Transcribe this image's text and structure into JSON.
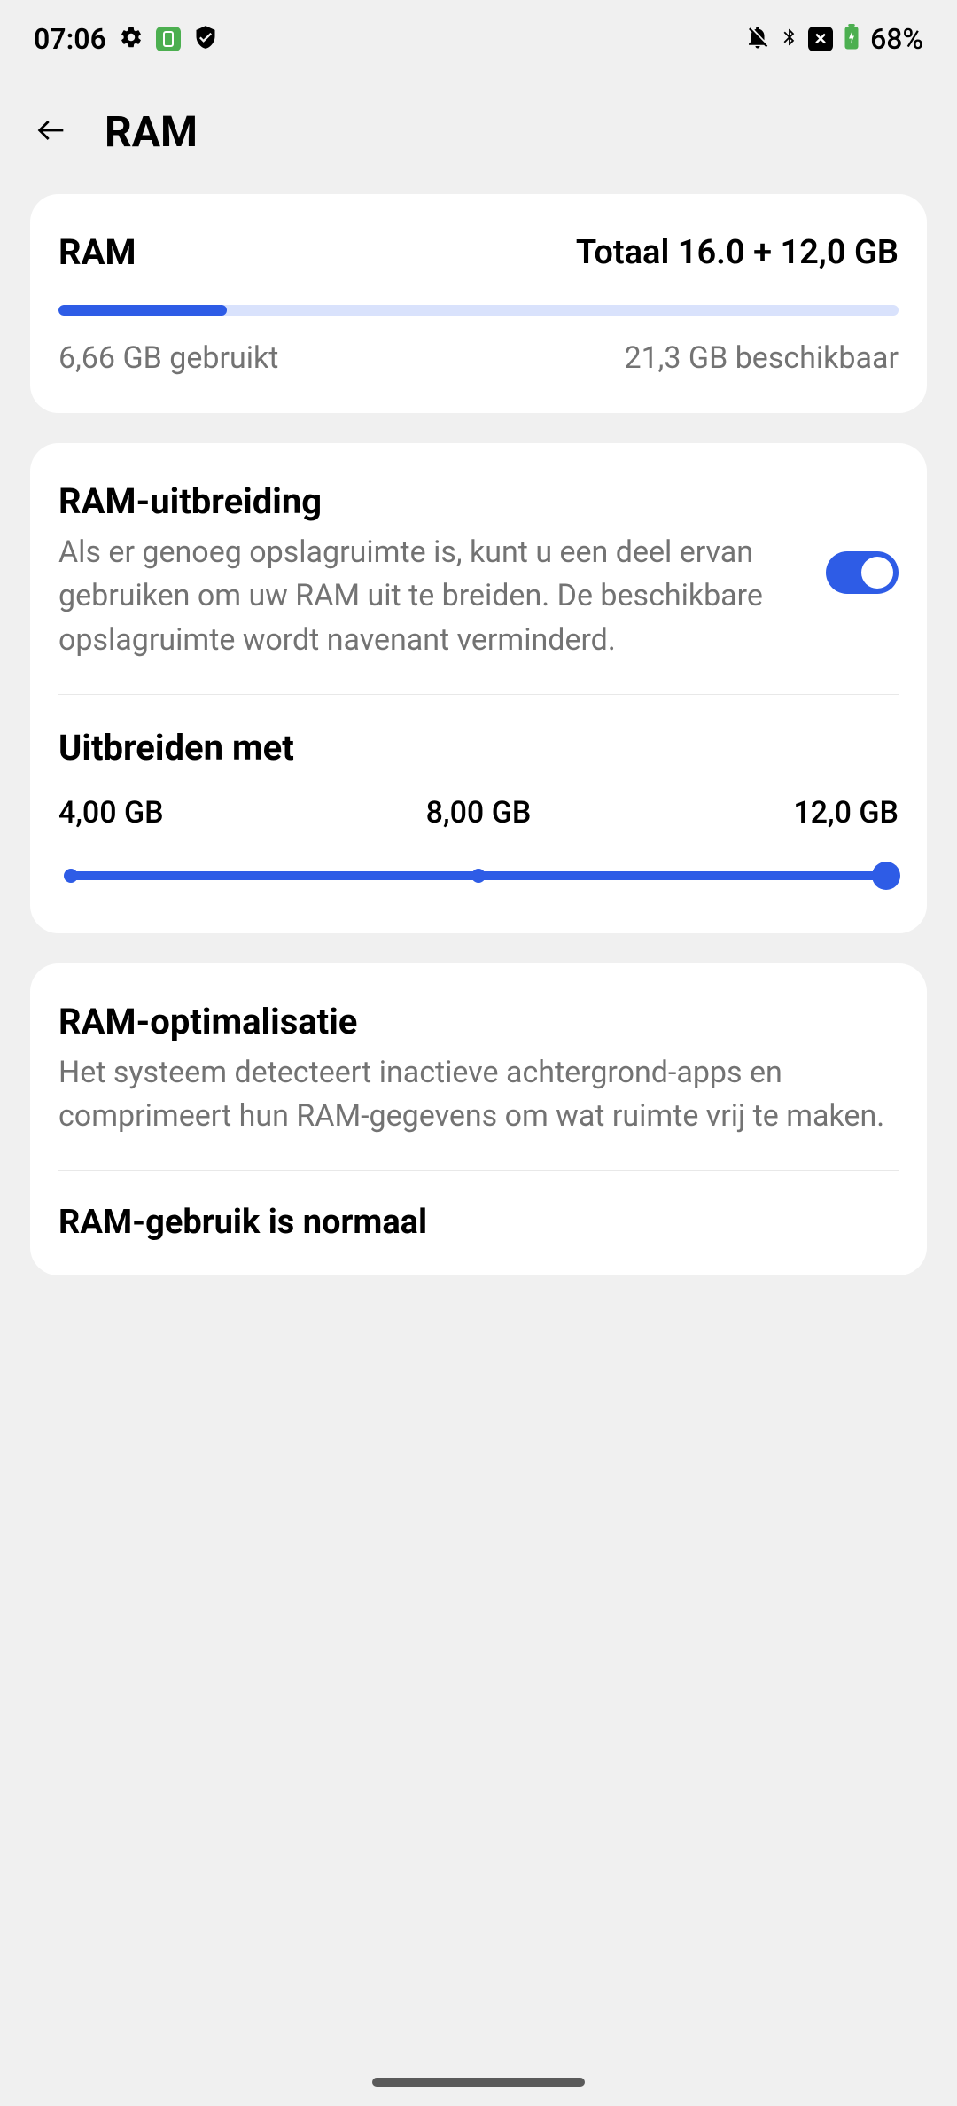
{
  "status_bar": {
    "time": "07:06",
    "battery_percent": "68%"
  },
  "header": {
    "title": "RAM"
  },
  "ram_card": {
    "label": "RAM",
    "total": "Totaal 16.0 + 12,0 GB",
    "used": "6,66 GB gebruikt",
    "available": "21,3 GB beschikbaar",
    "used_percent": 20
  },
  "expansion": {
    "title": "RAM-uitbreiding",
    "description": "Als er genoeg opslagruimte is, kunt u een deel ervan gebruiken om uw RAM uit te breiden. De beschikbare opslagruimte wordt navenant verminderd.",
    "toggle_on": true,
    "extend_title": "Uitbreiden met",
    "options": [
      "4,00 GB",
      "8,00 GB",
      "12,0 GB"
    ],
    "selected_index": 2
  },
  "optimization": {
    "title": "RAM-optimalisatie",
    "description": "Het systeem detecteert inactieve achtergrond-apps en comprimeert hun RAM-gegevens om wat ruimte vrij te maken.",
    "status": "RAM-gebruik is normaal"
  }
}
